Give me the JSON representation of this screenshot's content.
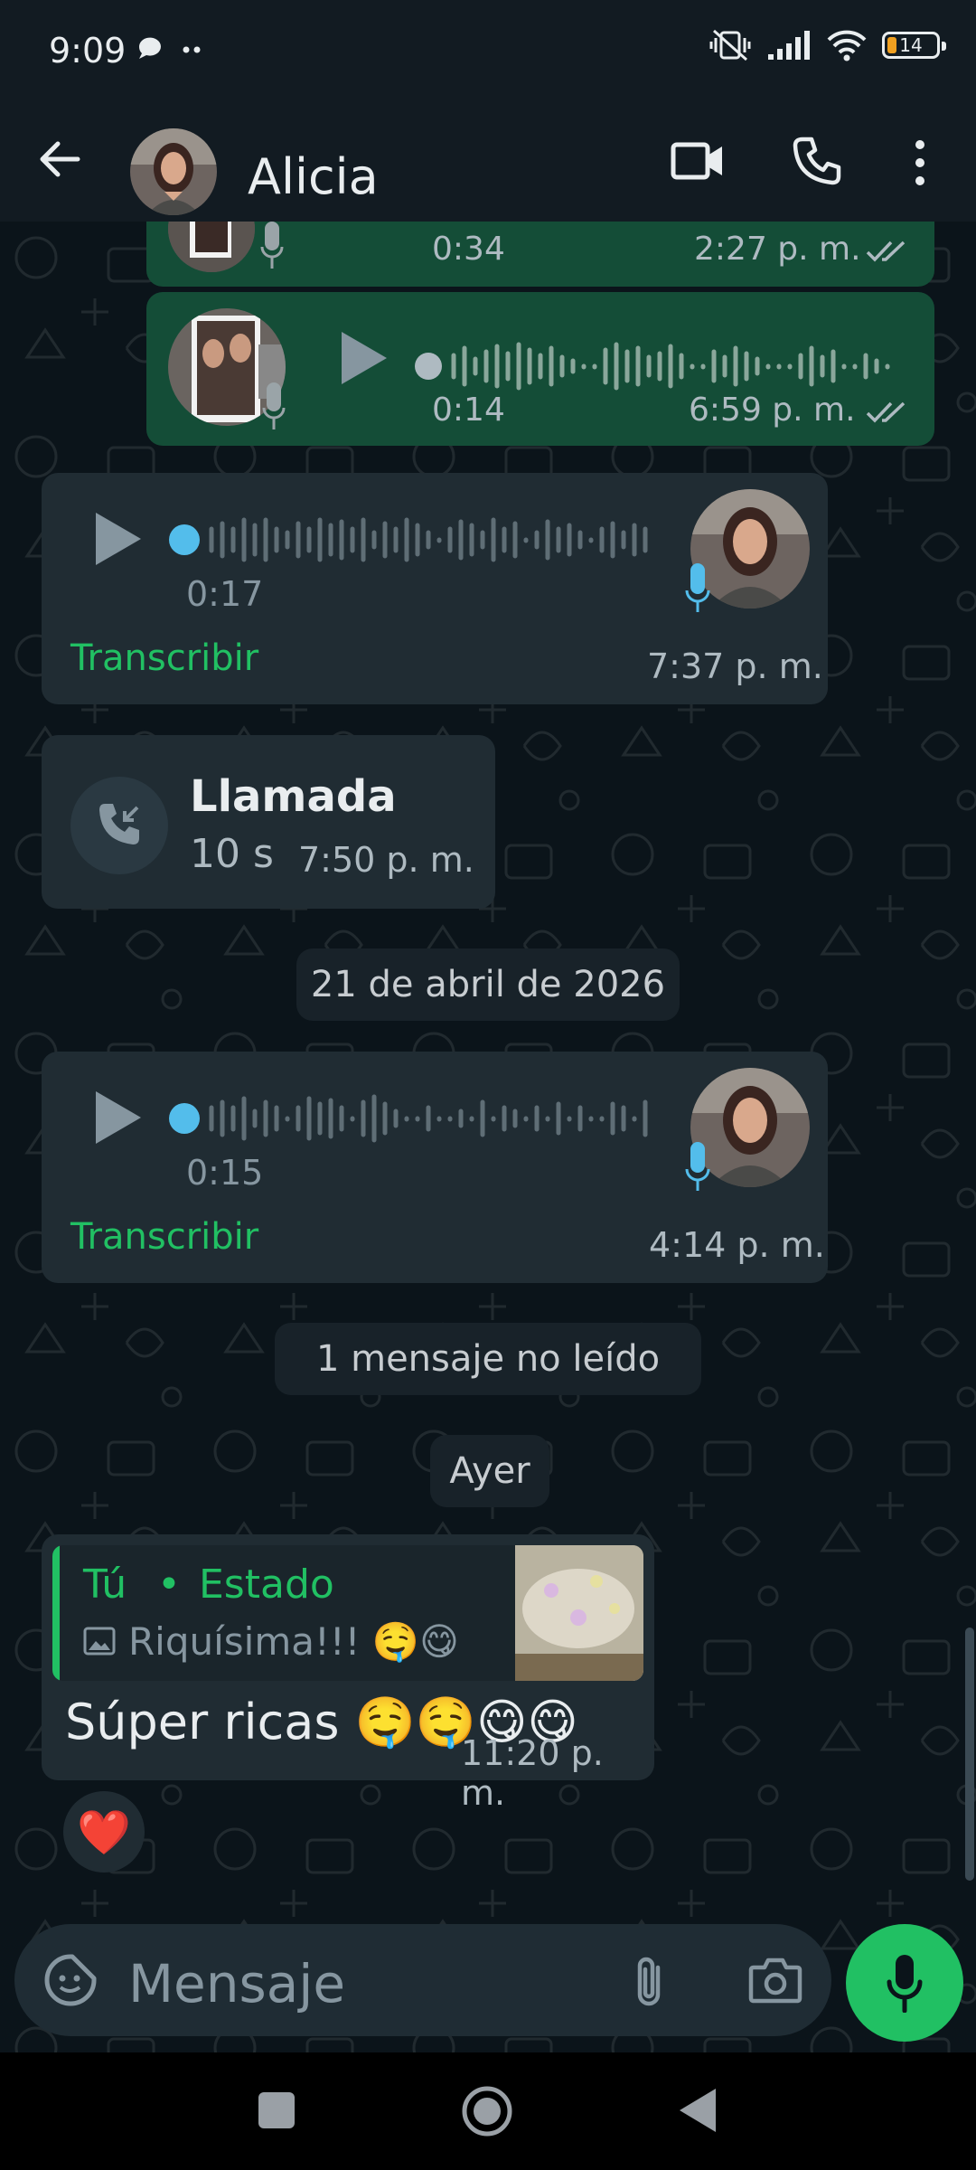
{
  "status_bar": {
    "time": "9:09",
    "battery_level": "14"
  },
  "header": {
    "contact_name": "Alicia"
  },
  "messages": [
    {
      "type": "voice_out",
      "duration": "0:34",
      "time": "2:27 p. m."
    },
    {
      "type": "voice_out",
      "duration": "0:14",
      "time": "6:59 p. m."
    },
    {
      "type": "voice_in",
      "duration": "0:17",
      "time": "7:37 p. m.",
      "action": "Transcribir"
    },
    {
      "type": "call",
      "title": "Llamada",
      "duration": "10 s",
      "time": "7:50 p. m."
    },
    {
      "type": "voice_in",
      "duration": "0:15",
      "time": "4:14 p. m.",
      "action": "Transcribir"
    },
    {
      "type": "reply",
      "quote_author": "Tú",
      "quote_context": "Estado",
      "quote_text": "Riquísima!!! 🤤😋",
      "text": "Súper ricas 🤤🤤😋😋",
      "time": "11:20 p. m.",
      "reaction": "❤️"
    }
  ],
  "dividers": {
    "date": "21 de abril de 2026",
    "unread": "1 mensaje no leído",
    "yesterday": "Ayer"
  },
  "input": {
    "placeholder": "Mensaje"
  },
  "colors": {
    "outgoing_bubble": "#144d37",
    "incoming_bubble": "#202c33",
    "accent": "#21c063",
    "unplayed_dot": "#53bdeb"
  }
}
